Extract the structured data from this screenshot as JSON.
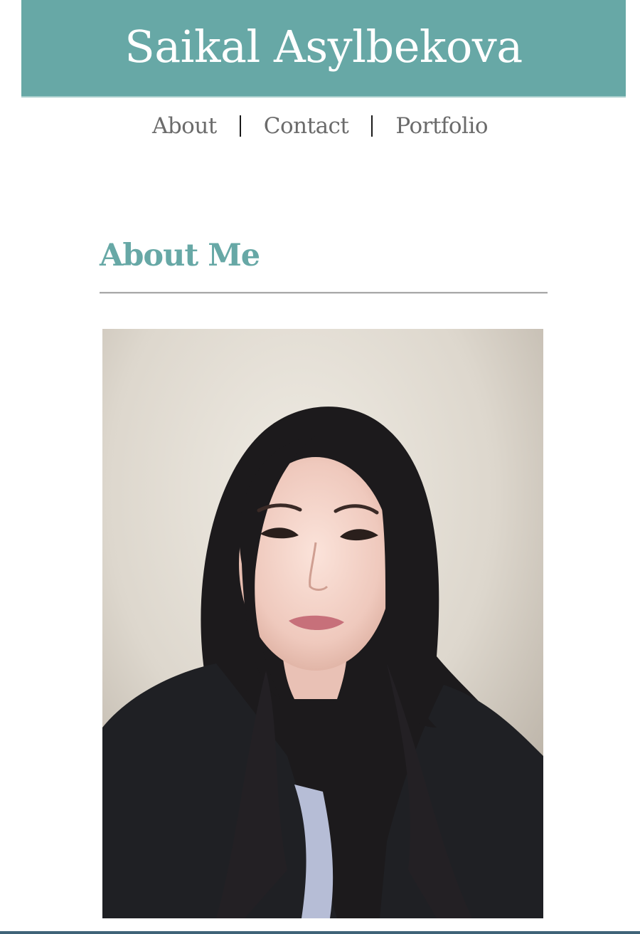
{
  "header": {
    "title": "Saikal Asylbekova",
    "background_color": "#67a8a6"
  },
  "nav": {
    "items": [
      {
        "label": "About"
      },
      {
        "label": "Contact"
      },
      {
        "label": "Portfolio"
      }
    ],
    "separator": "|"
  },
  "about": {
    "heading": "About Me",
    "heading_color": "#67a8a6",
    "photo": {
      "icon": "profile-photo",
      "description": "portrait"
    }
  }
}
